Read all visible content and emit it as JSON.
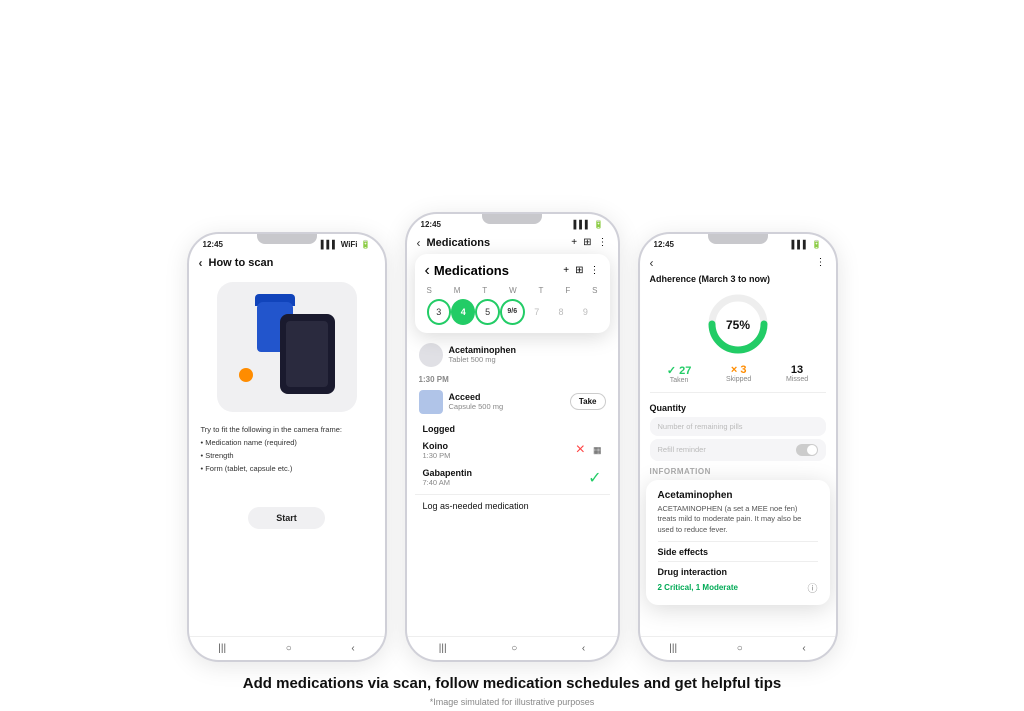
{
  "phones": {
    "phone1": {
      "time": "12:45",
      "title": "How to scan",
      "instructions": {
        "intro": "Try to fit the following in the camera frame:",
        "items": [
          "Medication name (required)",
          "Strength",
          "Form (tablet, capsule etc.)"
        ]
      },
      "start_button": "Start"
    },
    "phone2": {
      "time": "12:45",
      "header_title": "Medications",
      "calendar": {
        "title": "Medications",
        "days_header": [
          "S",
          "M",
          "T",
          "W",
          "T",
          "F",
          "S"
        ],
        "days": [
          "3",
          "4",
          "5",
          "9/6",
          "7",
          "8",
          "9"
        ]
      },
      "medications": [
        {
          "name": "Acetaminophen",
          "dose": "Tablet 500 mg",
          "time": ""
        }
      ],
      "time_label": "1:30 PM",
      "med2": {
        "name": "Acceed",
        "dose": "Capsule 500 mg",
        "take_button": "Take"
      },
      "logged_label": "Logged",
      "logged_items": [
        {
          "name": "Koino",
          "time": "1:30 PM",
          "status": "x"
        },
        {
          "name": "Gabapentin",
          "time": "7:40 AM",
          "status": "check"
        }
      ],
      "log_as_needed": "Log as-needed medication"
    },
    "phone3": {
      "time": "12:45",
      "adherence_title": "Adherence (March 3 to now)",
      "progress_percent": "75%",
      "stats": {
        "taken": {
          "value": "✓ 27",
          "label": "Taken"
        },
        "skipped": {
          "value": "× 3",
          "label": "Skipped"
        },
        "missed": {
          "value": "13",
          "label": "Missed"
        }
      },
      "quantity_title": "Quantity",
      "remaining_pills_placeholder": "Number of remaining pills",
      "refill_reminder": "Refill reminder",
      "information_label": "Information",
      "info_card": {
        "title": "Acetaminophen",
        "description": "ACETAMINOPHEN (a set a MEE noe fen) treats mild to moderate pain. It may also be used to reduce fever.",
        "side_effects": "Side effects",
        "drug_interaction": "Drug interaction",
        "drug_critical_text": "2 Critical, 1 Moderate"
      }
    }
  },
  "caption": "Add medications via scan, follow medication schedules and get helpful tips",
  "disclaimer": "*Image simulated for illustrative purposes",
  "icons": {
    "back": "‹",
    "add": "+",
    "calendar": "📅",
    "more": "⋮",
    "check": "✓",
    "x": "×",
    "info": "ⓘ",
    "bars": "|||",
    "circle": "○",
    "chevron": "‹"
  },
  "colors": {
    "green": "#22cc66",
    "orange": "#ff8c00",
    "red": "#ff4444",
    "dark": "#111111",
    "gray": "#888888",
    "light_gray": "#f5f5f7"
  }
}
